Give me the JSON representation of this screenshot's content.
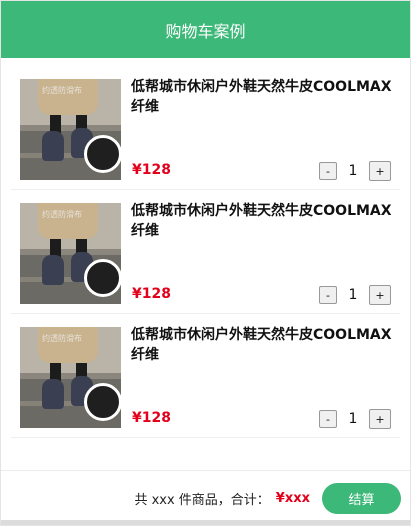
{
  "header": {
    "title": "购物车案例"
  },
  "items": [
    {
      "title": "低帮城市休闲户外鞋天然牛皮COOLMAX纤维",
      "price": "¥128",
      "quantity": "1",
      "minus": "-",
      "plus": "+",
      "watermark": "约透防滑布"
    },
    {
      "title": "低帮城市休闲户外鞋天然牛皮COOLMAX纤维",
      "price": "¥128",
      "quantity": "1",
      "minus": "-",
      "plus": "+",
      "watermark": "约透防滑布"
    },
    {
      "title": "低帮城市休闲户外鞋天然牛皮COOLMAX纤维",
      "price": "¥128",
      "quantity": "1",
      "minus": "-",
      "plus": "+",
      "watermark": "约透防滑布"
    }
  ],
  "footer": {
    "summary": "共 xxx 件商品，合计：",
    "total": "¥xxx",
    "checkout_label": "结算"
  },
  "colors": {
    "brand": "#3cb878",
    "price": "#e3001b"
  }
}
